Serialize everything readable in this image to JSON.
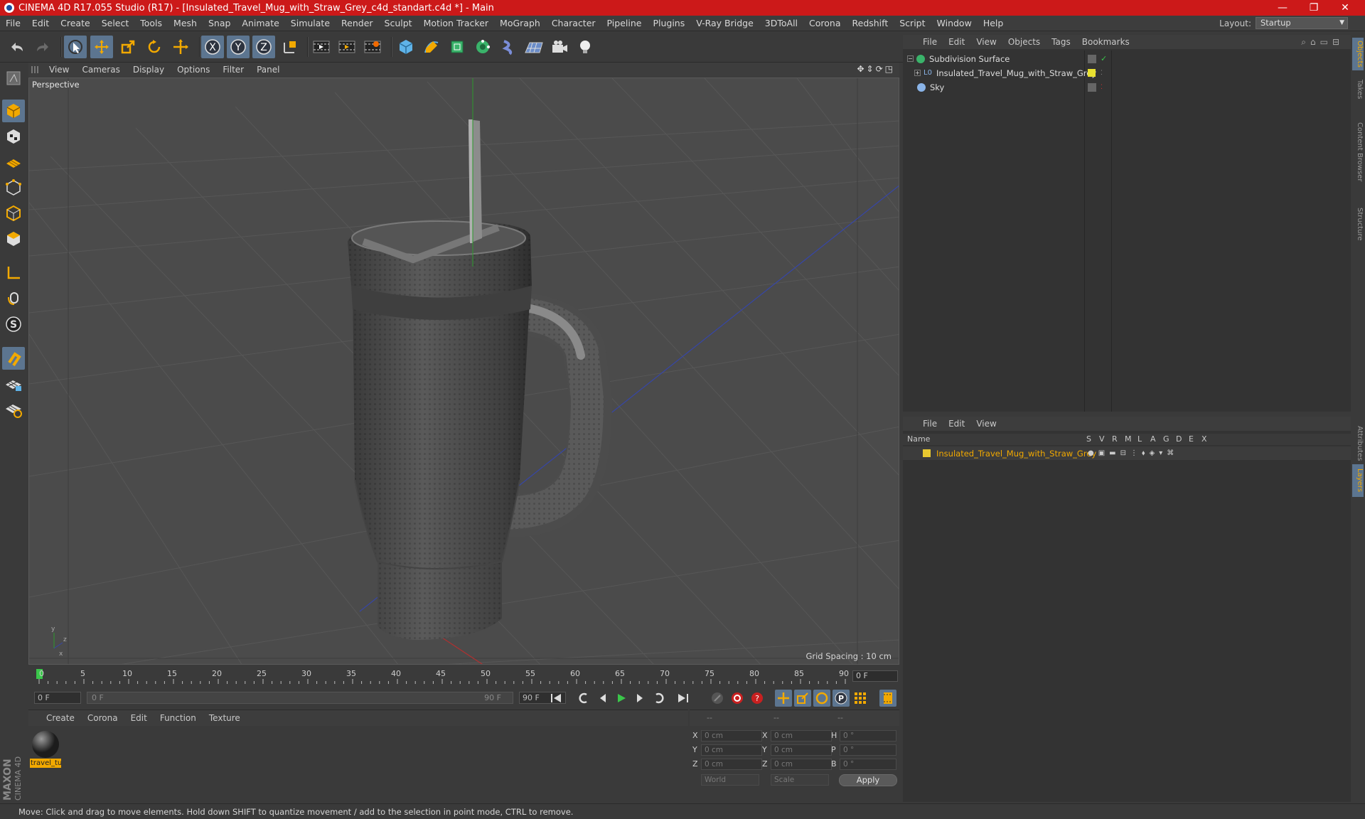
{
  "app": {
    "title": "CINEMA 4D R17.055 Studio (R17) - [Insulated_Travel_Mug_with_Straw_Grey_c4d_standart.c4d *] - Main",
    "layout_label": "Layout:",
    "layout_value": "Startup"
  },
  "menu": [
    "File",
    "Edit",
    "Create",
    "Select",
    "Tools",
    "Mesh",
    "Snap",
    "Animate",
    "Simulate",
    "Render",
    "Sculpt",
    "Motion Tracker",
    "MoGraph",
    "Character",
    "Pipeline",
    "Plugins",
    "V-Ray Bridge",
    "3DToAll",
    "Corona",
    "Redshift",
    "Script",
    "Window",
    "Help"
  ],
  "viewport": {
    "menu": [
      "View",
      "Cameras",
      "Display",
      "Options",
      "Filter",
      "Panel"
    ],
    "label": "Perspective",
    "grid_spacing": "Grid Spacing : 10 cm"
  },
  "timeline": {
    "ticks": [
      "0",
      "5",
      "10",
      "15",
      "20",
      "25",
      "30",
      "35",
      "40",
      "45",
      "50",
      "55",
      "60",
      "65",
      "70",
      "75",
      "80",
      "85",
      "90"
    ],
    "current_frame": "0 F"
  },
  "transport": {
    "start": "0 F",
    "range_start": "0 F",
    "range_end": "90 F",
    "end": "90 F"
  },
  "materials": {
    "menu": [
      "Create",
      "Corona",
      "Edit",
      "Function",
      "Texture"
    ],
    "items": [
      {
        "name": "travel_tu"
      }
    ]
  },
  "coords": {
    "header": [
      "--",
      "--",
      "--"
    ],
    "rows": [
      {
        "a": "X",
        "av": "0 cm",
        "b": "X",
        "bv": "0 cm",
        "c": "H",
        "cv": "0 °"
      },
      {
        "a": "Y",
        "av": "0 cm",
        "b": "Y",
        "bv": "0 cm",
        "c": "P",
        "cv": "0 °"
      },
      {
        "a": "Z",
        "av": "0 cm",
        "b": "Z",
        "bv": "0 cm",
        "c": "B",
        "cv": "0 °"
      }
    ],
    "mode1": "World",
    "mode2": "Scale",
    "apply": "Apply"
  },
  "objects": {
    "menu": [
      "File",
      "Edit",
      "View",
      "Objects",
      "Tags",
      "Bookmarks"
    ],
    "items": [
      {
        "name": "Subdivision Surface"
      },
      {
        "name": "Insulated_Travel_Mug_with_Straw_Grey"
      },
      {
        "name": "Sky"
      }
    ]
  },
  "layers": {
    "menu": [
      "File",
      "Edit",
      "View"
    ],
    "columns": {
      "name": "Name",
      "flags": [
        "S",
        "V",
        "R",
        "M",
        "L",
        "A",
        "G",
        "D",
        "E",
        "X"
      ]
    },
    "items": [
      {
        "name": "Insulated_Travel_Mug_with_Straw_Grey",
        "color": "#e8c830"
      }
    ]
  },
  "side_tabs": [
    "Objects",
    "Takes",
    "Content Browser",
    "Structure",
    "Attributes",
    "Layers"
  ],
  "brand": {
    "line1": "MAXON",
    "line2": "CINEMA 4D"
  },
  "status": "Move: Click and drag to move elements. Hold down SHIFT to quantize movement / add to the selection in point mode, CTRL to remove.",
  "colors": {
    "titlebar": "#cc1919",
    "accent": "#5c7590",
    "selection": "#f2a900",
    "layer": "#e8c830"
  },
  "icons": [
    "undo-icon",
    "redo-icon",
    "select-icon",
    "move-icon",
    "scale-icon",
    "rotate-icon",
    "axis-icon",
    "render-icon",
    "cube-icon",
    "pen-icon",
    "camera-icon",
    "light-icon",
    "play-icon",
    "record-icon"
  ]
}
